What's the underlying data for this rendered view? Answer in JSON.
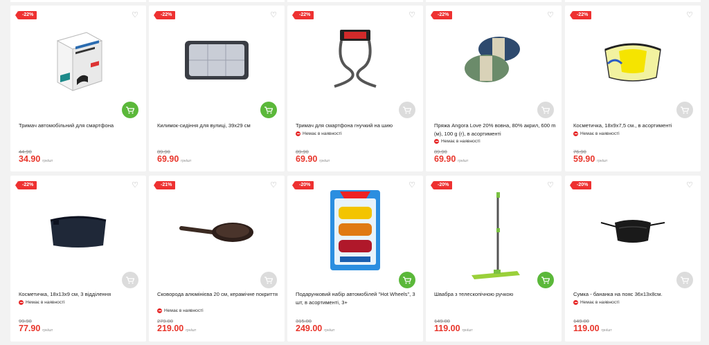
{
  "currency": "грн/шт",
  "row1": [
    {
      "discount": "-22%",
      "title": "Тримач автомобільний для смартфона",
      "stock": "",
      "old_price": "44.90",
      "price": "34.90",
      "in_stock": true
    },
    {
      "discount": "-22%",
      "title": "Килимок-сидіння для вулиці, 39х29 см",
      "stock": "",
      "old_price": "89.90",
      "price": "69.90",
      "in_stock": true
    },
    {
      "discount": "-22%",
      "title": "Тримач для смартфона гнучкий на шию",
      "stock": "Немає в наявності",
      "old_price": "89.90",
      "price": "69.90",
      "in_stock": false
    },
    {
      "discount": "-22%",
      "title": "Пряжа Angora Love 20% вовна, 80% акрил, 600 m (м), 100 g (г), в асортименті",
      "stock": "Немає в наявності",
      "old_price": "89.90",
      "price": "69.90",
      "in_stock": false
    },
    {
      "discount": "-22%",
      "title": "Косметичка, 18х9х7,5 см., в асортименті",
      "stock": "Немає в наявності",
      "old_price": "76.90",
      "price": "59.90",
      "in_stock": false
    }
  ],
  "row2": [
    {
      "discount": "-22%",
      "title": "Косметичка, 18х13х9 см, 3 відділення",
      "stock": "Немає в наявності",
      "old_price": "99.90",
      "price": "77.90",
      "in_stock": false
    },
    {
      "discount": "-21%",
      "title": "Сковорода алюмінієва 20 см, керамічне покриття",
      "stock": "Немає в наявності",
      "old_price": "279.00",
      "price": "219.00",
      "in_stock": false
    },
    {
      "discount": "-20%",
      "title": "Подарунковий набір автомобілей \"Hot Wheels\", 3 шт, в асортименті, 3+",
      "stock": "",
      "old_price": "315.00",
      "price": "249.00",
      "in_stock": true
    },
    {
      "discount": "-20%",
      "title": "Швабра з телескопічною ручкою",
      "stock": "",
      "old_price": "149.00",
      "price": "119.00",
      "in_stock": true
    },
    {
      "discount": "-20%",
      "title": "Сумка - бананка на пояс 36х13х8см.",
      "stock": "Немає в наявності",
      "old_price": "149.00",
      "price": "119.00",
      "in_stock": false
    }
  ]
}
